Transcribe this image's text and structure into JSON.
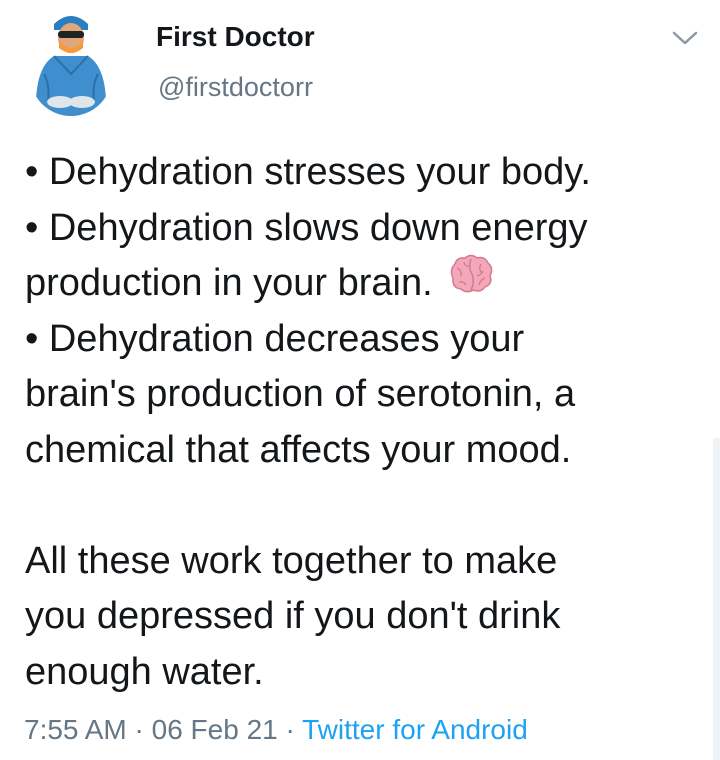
{
  "author": {
    "display_name": "First Doctor",
    "handle": "@firstdoctorr"
  },
  "tweet": {
    "lines": [
      "• Dehydration stresses your body.",
      "• Dehydration slows down energy",
      "production in your brain.",
      "• Dehydration decreases your",
      "brain's production of serotonin, a",
      "chemical that affects your mood.",
      "",
      "All these work together to make",
      "you depressed if you don't drink",
      "enough water."
    ],
    "emoji": "brain-emoji"
  },
  "meta": {
    "time": "7:55 AM",
    "separator": "·",
    "date": "06 Feb 21",
    "source": "Twitter for Android"
  },
  "colors": {
    "text": "#14171a",
    "secondary": "#657786",
    "link": "#1da1f2"
  },
  "icons": [
    "avatar",
    "chevron-down-icon",
    "brain-emoji"
  ]
}
